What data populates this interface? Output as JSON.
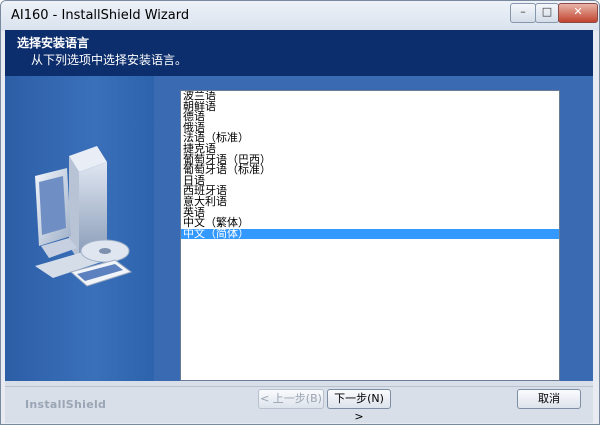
{
  "window": {
    "title": "AI160 - InstallShield Wizard"
  },
  "titlebar_buttons": {
    "minimize": "–",
    "maximize": "□",
    "close": "✕"
  },
  "header": {
    "title": "选择安装语言",
    "subtitle": "从下列选项中选择安装语言。"
  },
  "languages": [
    "波兰语",
    "朝鲜语",
    "德语",
    "俄语",
    "法语（标准）",
    "捷克语",
    "葡萄牙语（巴西）",
    "葡萄牙语（标准）",
    "日语",
    "西班牙语",
    "意大利语",
    "英语",
    "中文（繁体）",
    "中文（简体）"
  ],
  "selected_index": 13,
  "footer": {
    "brand": "InstallShield",
    "back_label": "< 上一步(B)",
    "next_label": "下一步(N) >",
    "cancel_label": "取消"
  },
  "colors": {
    "header_bg": "#0d2e6c",
    "panel_bg": "#3a6bb2",
    "selection": "#3399ff"
  }
}
